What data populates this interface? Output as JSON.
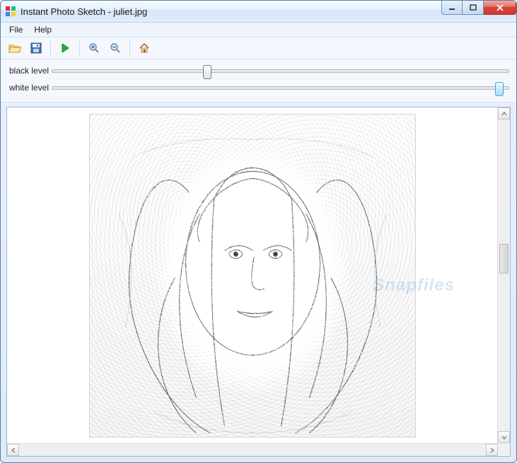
{
  "window": {
    "title": "Instant Photo Sketch - juliet.jpg"
  },
  "menu": {
    "file": "File",
    "help": "Help"
  },
  "toolbar": {
    "open": "open-icon",
    "save": "save-icon",
    "run": "play-icon",
    "zoom_in": "zoom-in-icon",
    "zoom_out": "zoom-out-icon",
    "home": "home-icon"
  },
  "sliders": {
    "black": {
      "label": "black level",
      "value": 34,
      "min": 0,
      "max": 100
    },
    "white": {
      "label": "white level",
      "value": 98,
      "min": 0,
      "max": 100
    }
  },
  "canvas": {
    "watermark": "Snapfiles"
  }
}
